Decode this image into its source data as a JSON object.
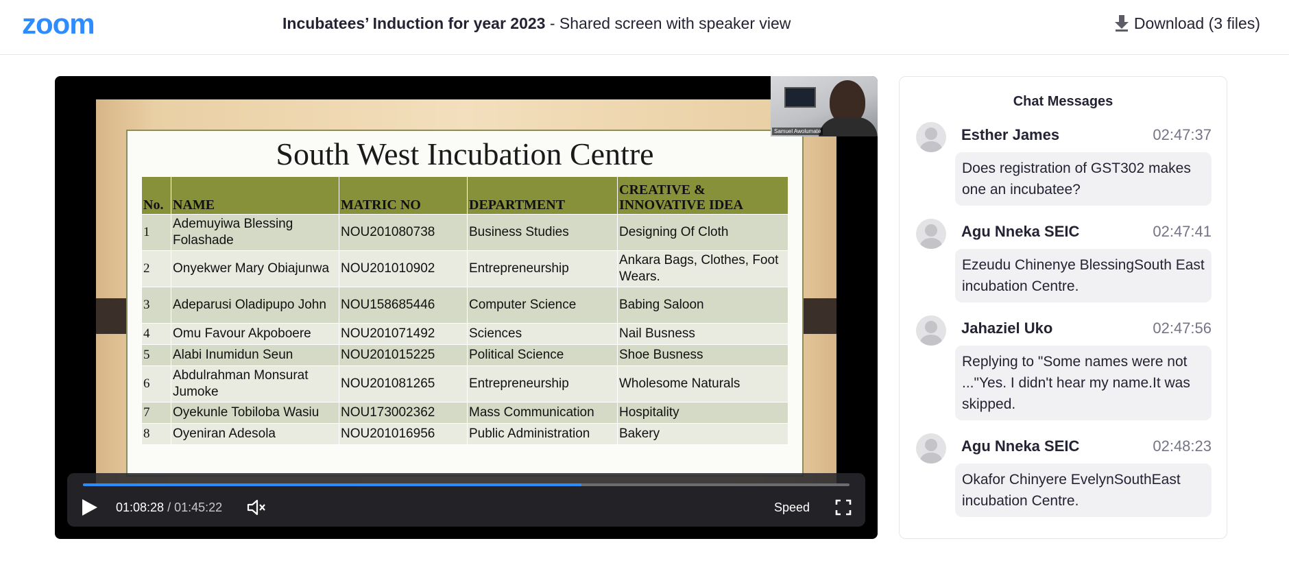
{
  "header": {
    "logo_text": "zoom",
    "title_strong": "Incubatees’ Induction for year 2023",
    "title_rest": " - Shared screen with speaker view",
    "download_label": "Download (3 files)",
    "brand_color": "#2d8cff"
  },
  "slide": {
    "title": "South West Incubation Centre",
    "columns": [
      "No.",
      "NAME",
      "MATRIC NO",
      "DEPARTMENT",
      "CREATIVE & INNOVATIVE IDEA"
    ],
    "rows": [
      [
        "1",
        "Ademuyiwa Blessing Folashade",
        "NOU201080738",
        "Business Studies",
        "Designing Of Cloth"
      ],
      [
        "2",
        "Onyekwer Mary Obiajunwa",
        "NOU201010902",
        "Entrepreneurship",
        "Ankara Bags, Clothes, Foot Wears."
      ],
      [
        "3",
        "Adeparusi Oladipupo John",
        "NOU158685446",
        "Computer Science",
        "Babing Saloon"
      ],
      [
        "4",
        "Omu Favour Akpoboere",
        "NOU201071492",
        "Sciences",
        "Nail Busness"
      ],
      [
        "5",
        "Alabi Inumidun Seun",
        "NOU201015225",
        "Political Science",
        "Shoe Busness"
      ],
      [
        "6",
        "Abdulrahman Monsurat Jumoke",
        "NOU201081265",
        "Entrepreneurship",
        "Wholesome Naturals"
      ],
      [
        "7",
        "Oyekunle Tobiloba Wasiu",
        "NOU173002362",
        "Mass Communication",
        "Hospitality"
      ],
      [
        "8",
        "Oyeniran Adesola",
        "NOU201016956",
        "Public Administration",
        "Bakery"
      ]
    ],
    "header_color": "#86913a"
  },
  "camera": {
    "speaker_name": "Samuel Awolumate"
  },
  "player": {
    "current_time": "01:08:28",
    "separator": "/",
    "duration": "01:45:22",
    "progress_fraction": 0.65,
    "speed_label": "Speed"
  },
  "chat": {
    "title": "Chat Messages",
    "messages": [
      {
        "sender": "Esther James",
        "time": "02:47:37",
        "text": "Does registration of GST302 makes one an incubatee?"
      },
      {
        "sender": "Agu Nneka SEIC",
        "time": "02:47:41",
        "text": "Ezeudu Chinenye BlessingSouth East incubation Centre."
      },
      {
        "sender": "Jahaziel Uko",
        "time": "02:47:56",
        "text": "Replying to \"Some names were not ...\"Yes. I didn't hear my name.It was skipped."
      },
      {
        "sender": "Agu Nneka SEIC",
        "time": "02:48:23",
        "text": "Okafor Chinyere EvelynSouthEast incubation Centre."
      }
    ]
  },
  "icons": {
    "download": "download-arrow-icon",
    "play": "play-icon",
    "volume": "speaker-icon",
    "fullscreen": "fullscreen-icon",
    "avatar": "user-avatar-icon"
  }
}
